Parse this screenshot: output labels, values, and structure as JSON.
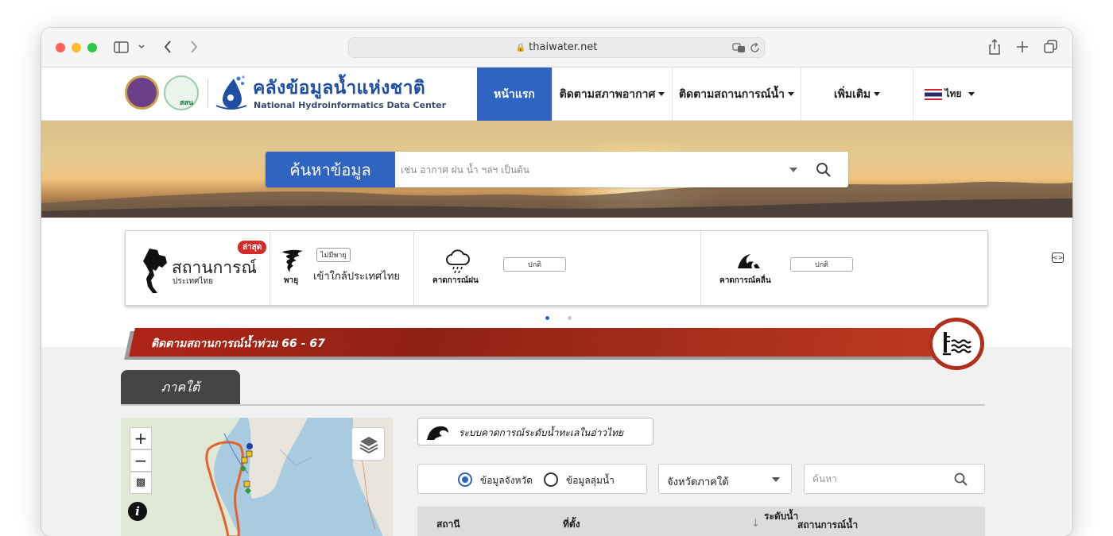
{
  "browser": {
    "url": "thaiwater.net"
  },
  "header": {
    "brand_th": "คลังข้อมูลน้ำแห่งชาติ",
    "brand_en": "National Hydroinformatics Data Center",
    "logo2_text": "สสน",
    "nav": [
      {
        "label": "หน้าแรก"
      },
      {
        "label": "ติดตามสภาพอากาศ"
      },
      {
        "label": "ติดตามสถานการณ์น้ำ"
      },
      {
        "label": "เพิ่มเติม"
      }
    ],
    "language": "ไทย"
  },
  "search": {
    "label": "ค้นหาข้อมูล",
    "placeholder": "เช่น อากาศ ฝน น้ำ ฯลฯ เป็นต้น"
  },
  "cards": {
    "situation_title": "สถานการณ์",
    "situation_sub": "ประเทศไทย",
    "latest_badge": "ล่าสุด",
    "storm_tag": "ไม่มีพายุ",
    "storm_icon_label": "พายุ",
    "storm_text": "เข้าใกล้ประเทศไทย",
    "rain_label": "คาดการณ์ฝน",
    "rain_status": "ปกติ",
    "wave_label": "คาดการณ์คลื่น",
    "wave_status": "ปกติ"
  },
  "flood": {
    "banner_text": "ติดตามสถานการณ์น้ำท่วม 66 - 67"
  },
  "region_tab": "ภาคใต้",
  "forecast_button": "ระบบคาดการณ์ระดับน้ำทะเลในอ่าวไทย",
  "filters": {
    "radio_province": "ข้อมูลจังหวัด",
    "radio_basin": "ข้อมูลลุ่มน้ำ",
    "province_select": "จังหวัดภาคใต้",
    "search_placeholder": "ค้นหา"
  },
  "table": {
    "headers": [
      "สถานี",
      "ที่ตั้ง",
      "ระดับน้ำ",
      "สถานการณ์น้ำ"
    ]
  },
  "colors": {
    "primary": "#2f64c0",
    "flood_banner": "#b02418"
  }
}
